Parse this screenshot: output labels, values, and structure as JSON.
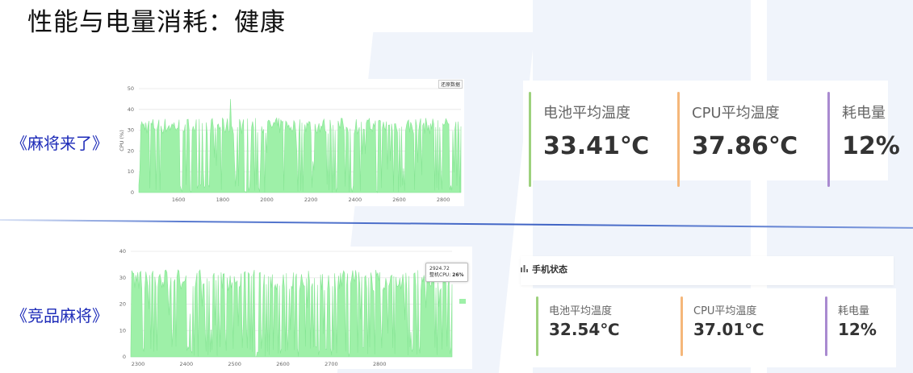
{
  "page_title": "性能与电量消耗：健康",
  "sections": [
    {
      "game_label": "《麻将来了》",
      "legend_tag": "还原数据",
      "chart_data": {
        "type": "area",
        "ylabel": "CPU (%)",
        "x_ticks": [
          1600,
          1800,
          2000,
          2200,
          2400,
          2600,
          2800
        ],
        "y_ticks": [
          0,
          10,
          20,
          30,
          40,
          50
        ],
        "xlim": [
          1420,
          2880
        ],
        "ylim": [
          0,
          50
        ],
        "series_color": "#9ef0a8",
        "typical_high": 34,
        "spike": {
          "x": 1835,
          "y": 45
        }
      },
      "stats": [
        {
          "label": "电池平均温度",
          "value": "33.41℃",
          "color": "#9dd17d"
        },
        {
          "label": "CPU平均温度",
          "value": "37.86℃",
          "color": "#f5b77a"
        },
        {
          "label": "耗电量",
          "value": "12%",
          "color": "#a98ad0"
        }
      ]
    },
    {
      "game_label": "《竞品麻将》",
      "status_title": "手机状态",
      "tooltip": {
        "x": "2924.72",
        "label": "整机CPU:",
        "value": "26%"
      },
      "chart_data": {
        "type": "area",
        "x_ticks": [
          2300,
          2400,
          2500,
          2600,
          2700,
          2800
        ],
        "y_ticks": [
          0,
          10,
          20,
          30,
          40
        ],
        "xlim": [
          2285,
          2950
        ],
        "ylim": [
          0,
          40
        ],
        "series_color": "#9ef0a8",
        "typical_high": 31
      },
      "stats": [
        {
          "label": "电池平均温度",
          "value": "32.54℃",
          "color": "#9dd17d"
        },
        {
          "label": "CPU平均温度",
          "value": "37.01℃",
          "color": "#f5b77a"
        },
        {
          "label": "耗电量",
          "value": "12%",
          "color": "#a98ad0"
        }
      ]
    }
  ]
}
